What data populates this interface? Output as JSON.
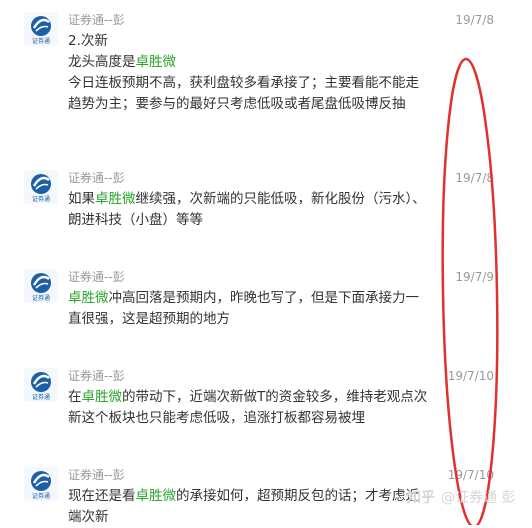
{
  "messages": [
    {
      "sender": "证券通--彭",
      "date": "19/7/8",
      "avatar_text": "证券通",
      "lines": [
        [
          {
            "text": "2.次新"
          }
        ],
        [
          {
            "text": "龙头高度是"
          },
          {
            "text": "卓胜微",
            "hl": true
          }
        ],
        [
          {
            "text": "今日连板预期不高，获利盘较多看承接了；主要看能不能走趋势为主；要参与的最好只考虑低吸或者尾盘低吸博反抽"
          }
        ]
      ]
    },
    {
      "sender": "证券通--彭",
      "date": "19/7/8",
      "avatar_text": "证券通",
      "lines": [
        [
          {
            "text": "如果"
          },
          {
            "text": "卓胜微",
            "hl": true
          },
          {
            "text": "继续强，次新端的只能低吸，新化股份（污水）、朗进科技（小盘）等等"
          }
        ]
      ]
    },
    {
      "sender": "证券通--彭",
      "date": "19/7/9",
      "avatar_text": "证券通",
      "lines": [
        [
          {
            "text": "卓胜微",
            "hl": true
          },
          {
            "text": "冲高回落是预期内，昨晚也写了，但是下面承接力一直很强，这是超预期的地方"
          }
        ]
      ]
    },
    {
      "sender": "证券通--彭",
      "date": "19/7/10",
      "avatar_text": "证券通",
      "lines": [
        [
          {
            "text": "在"
          },
          {
            "text": "卓胜微",
            "hl": true
          },
          {
            "text": "的带动下，近端次新做T的资金较多，维持老观点次新这个板块也只能考虑低吸，追涨打板都容易被埋"
          }
        ]
      ]
    },
    {
      "sender": "证券通--彭",
      "date": "19/7/10",
      "avatar_text": "证券通",
      "lines": [
        [
          {
            "text": "现在还是看"
          },
          {
            "text": "卓胜微",
            "hl": true
          },
          {
            "text": "的承接如何，超预期反包的话；才考虑近端次新"
          }
        ]
      ]
    }
  ],
  "watermark": {
    "logo": "知乎",
    "text": "@证券通 彭"
  },
  "colors": {
    "highlight": "#2aa52a",
    "annotation_oval": "#e0312f",
    "meta_text": "#9a9a9a"
  }
}
